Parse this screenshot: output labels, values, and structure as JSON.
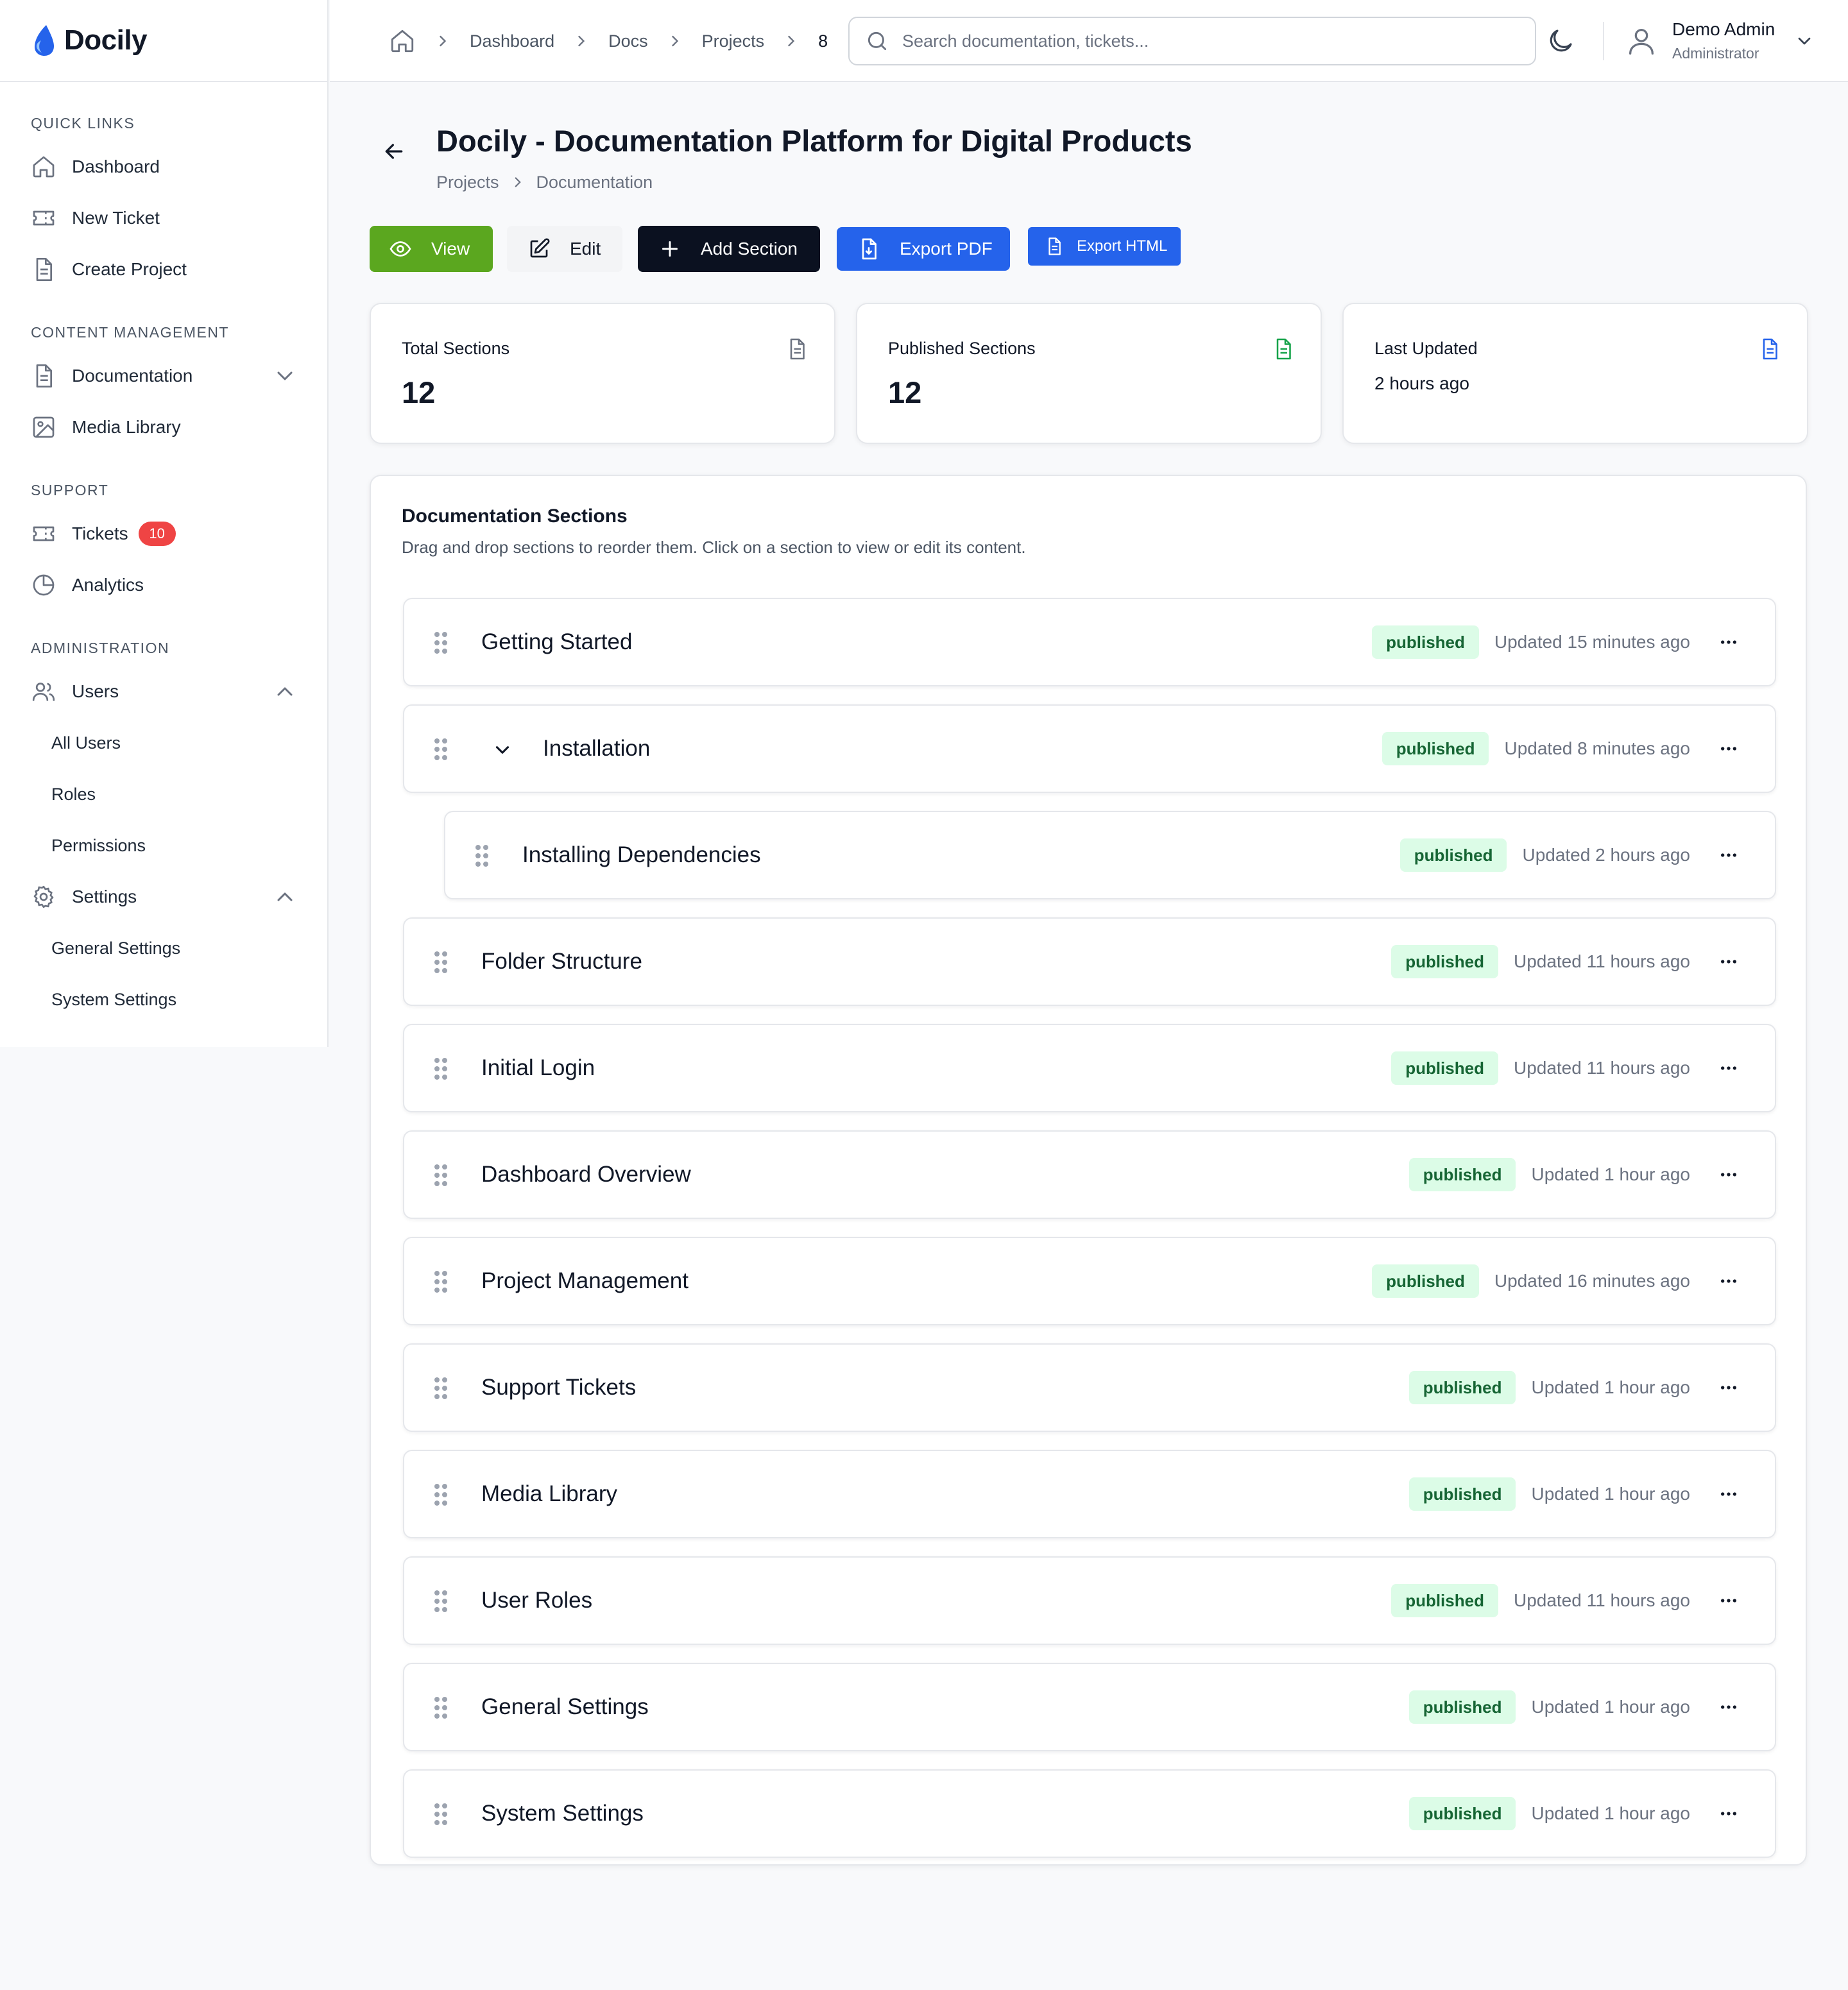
{
  "app": {
    "name": "Docily"
  },
  "colors": {
    "brand": "#2563eb",
    "view_button": "#5ba71f",
    "add_button": "#0b1120",
    "published_bg": "#dcfce7",
    "published_text": "#166534",
    "badge_red": "#ef4444",
    "published_icon": "#16a34a"
  },
  "sidebar": {
    "sections": [
      {
        "title": "QUICK LINKS",
        "items": [
          {
            "label": "Dashboard",
            "icon": "home-icon"
          },
          {
            "label": "New Ticket",
            "icon": "ticket-icon"
          },
          {
            "label": "Create Project",
            "icon": "document-icon"
          }
        ]
      },
      {
        "title": "CONTENT MANAGEMENT",
        "items": [
          {
            "label": "Documentation",
            "icon": "document-icon",
            "chevron": "down"
          },
          {
            "label": "Media Library",
            "icon": "image-icon"
          }
        ]
      },
      {
        "title": "SUPPORT",
        "items": [
          {
            "label": "Tickets",
            "icon": "ticket-icon",
            "badge": "10"
          },
          {
            "label": "Analytics",
            "icon": "pie-chart-icon"
          }
        ]
      },
      {
        "title": "ADMINISTRATION",
        "items": [
          {
            "label": "Users",
            "icon": "users-icon",
            "chevron": "up",
            "children": [
              "All Users",
              "Roles",
              "Permissions"
            ]
          },
          {
            "label": "Settings",
            "icon": "gear-icon",
            "chevron": "up",
            "children": [
              "General Settings",
              "System Settings"
            ]
          }
        ]
      }
    ]
  },
  "header": {
    "breadcrumb": [
      "Dashboard",
      "Docs",
      "Projects",
      "8"
    ],
    "search_placeholder": "Search documentation, tickets...",
    "user": {
      "name": "Demo Admin",
      "role": "Administrator"
    }
  },
  "page": {
    "title": "Docily - Documentation Platform for Digital Products",
    "breadcrumb": [
      "Projects",
      "Documentation"
    ]
  },
  "toolbar": {
    "view_label": "View",
    "edit_label": "Edit",
    "add_section_label": "Add Section",
    "export_pdf_label": "Export PDF",
    "export_html_label": "Export HTML"
  },
  "stats": {
    "total_sections": {
      "label": "Total Sections",
      "value": "12"
    },
    "published_sections": {
      "label": "Published Sections",
      "value": "12"
    },
    "last_updated": {
      "label": "Last Updated",
      "value": "2 hours ago"
    }
  },
  "sections_panel": {
    "title": "Documentation Sections",
    "description": "Drag and drop sections to reorder them. Click on a section to view or edit its content.",
    "rows": [
      {
        "title": "Getting Started",
        "status": "published",
        "updated": "Updated 15 minutes ago"
      },
      {
        "title": "Installation",
        "status": "published",
        "updated": "Updated 8 minutes ago",
        "expanded": true
      },
      {
        "title": "Installing Dependencies",
        "status": "published",
        "updated": "Updated 2 hours ago",
        "child": true
      },
      {
        "title": "Folder Structure",
        "status": "published",
        "updated": "Updated 11 hours ago"
      },
      {
        "title": "Initial Login",
        "status": "published",
        "updated": "Updated 11 hours ago"
      },
      {
        "title": "Dashboard Overview",
        "status": "published",
        "updated": "Updated 1 hour ago"
      },
      {
        "title": "Project Management",
        "status": "published",
        "updated": "Updated 16 minutes ago"
      },
      {
        "title": "Support Tickets",
        "status": "published",
        "updated": "Updated 1 hour ago"
      },
      {
        "title": "Media Library",
        "status": "published",
        "updated": "Updated 1 hour ago"
      },
      {
        "title": "User Roles",
        "status": "published",
        "updated": "Updated 11 hours ago"
      },
      {
        "title": "General Settings",
        "status": "published",
        "updated": "Updated 1 hour ago"
      },
      {
        "title": "System Settings",
        "status": "published",
        "updated": "Updated 1 hour ago"
      }
    ]
  }
}
